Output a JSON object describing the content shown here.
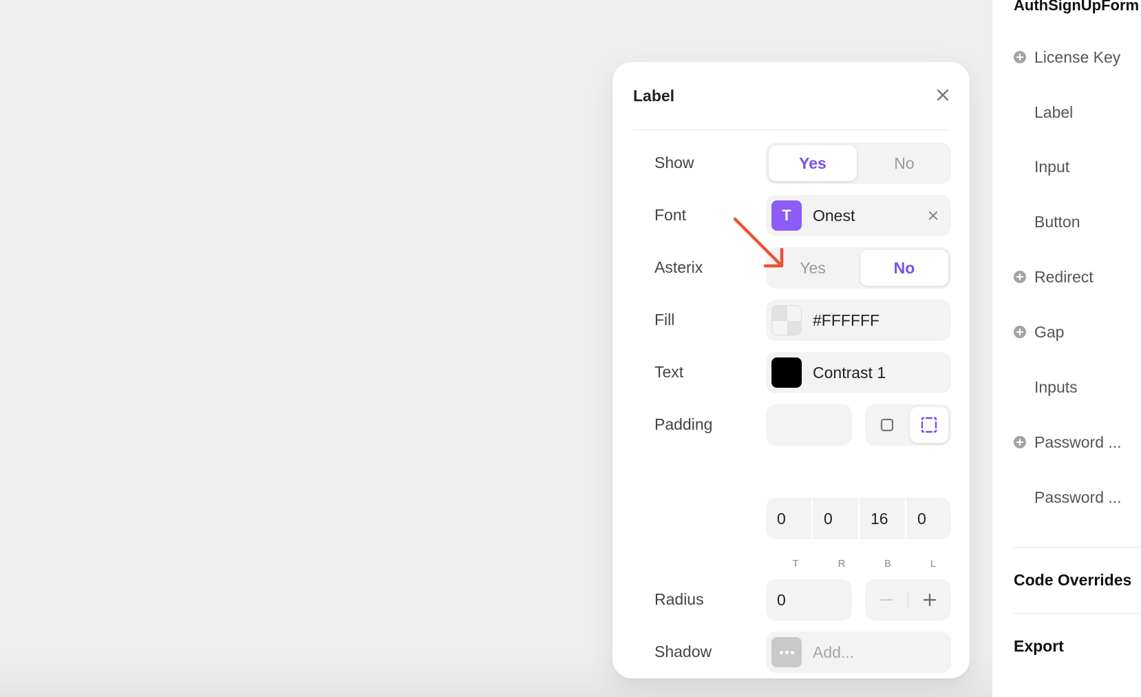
{
  "sidebar": {
    "header": "AuthSignUpForm",
    "items": [
      {
        "label": "License Key",
        "expandable": true
      },
      {
        "label": "Label",
        "expandable": false
      },
      {
        "label": "Input",
        "expandable": false
      },
      {
        "label": "Button",
        "expandable": false
      },
      {
        "label": "Redirect",
        "expandable": true
      },
      {
        "label": "Gap",
        "expandable": true
      },
      {
        "label": "Inputs",
        "expandable": false
      },
      {
        "label": "Password ...",
        "expandable": true
      },
      {
        "label": "Password ...",
        "expandable": false
      }
    ],
    "sections": {
      "code_overrides": "Code Overrides",
      "export": "Export"
    }
  },
  "panel": {
    "title": "Label",
    "show": {
      "label": "Show",
      "options": [
        "Yes",
        "No"
      ],
      "selected": "Yes"
    },
    "font": {
      "label": "Font",
      "icon_letter": "T",
      "value": "Onest"
    },
    "asterix": {
      "label": "Asterix",
      "options": [
        "Yes",
        "No"
      ],
      "selected": "No"
    },
    "fill": {
      "label": "Fill",
      "value": "#FFFFFF"
    },
    "text": {
      "label": "Text",
      "value": "Contrast 1"
    },
    "padding": {
      "label": "Padding",
      "mode": "per-side",
      "values": [
        "0",
        "0",
        "16",
        "0"
      ],
      "captions": [
        "T",
        "R",
        "B",
        "L"
      ]
    },
    "radius": {
      "label": "Radius",
      "value": "0"
    },
    "shadow": {
      "label": "Shadow",
      "placeholder": "Add..."
    }
  },
  "colors": {
    "accent": "#7A4FE8",
    "font_icon_bg": "#8B5CF6",
    "annotation_arrow": "#E8553A",
    "text_swatch": "#000000"
  }
}
